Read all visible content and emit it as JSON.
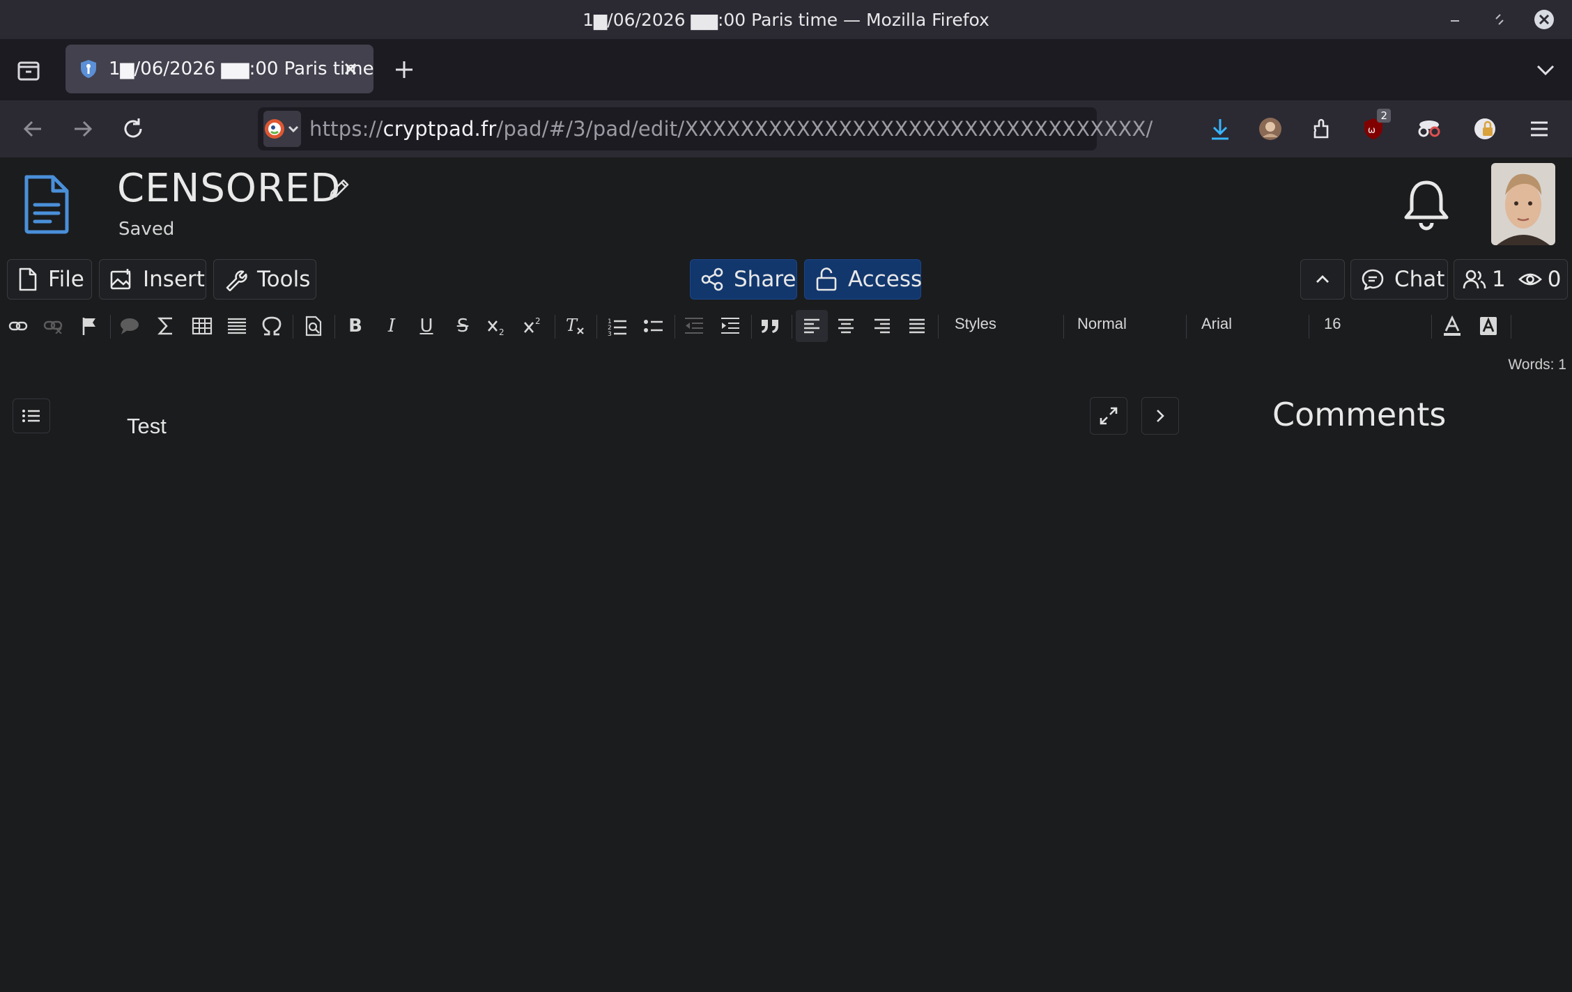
{
  "browser": {
    "window_title": "1▆/06/2026 ▆▆:00 Paris time — Mozilla Firefox",
    "tab_title": "1▆/06/2026 ▆▆:00 Paris time",
    "url": {
      "scheme": "https://",
      "host": "cryptpad.fr",
      "path": "/pad/#/3/pad/edit/XXXXXXXXXXXXXXXXXXXXXXXXXXXXXXXXX/"
    },
    "extension_badge": "2",
    "icons": [
      "back-icon",
      "forward-icon",
      "reload-icon",
      "download-icon",
      "profile-icon",
      "extensions-icon",
      "ublock-icon",
      "privacy-icon",
      "lock-extension-icon",
      "menu-icon"
    ]
  },
  "app": {
    "doc_title": "CENSORED",
    "save_status": "Saved",
    "menu": {
      "file": "File",
      "insert": "Insert",
      "tools": "Tools",
      "share": "Share",
      "access": "Access",
      "chat": "Chat",
      "users_count": "1",
      "viewers_count": "0"
    },
    "toolbar": {
      "styles": "Styles",
      "format": "Normal",
      "font": "Arial",
      "size": "16"
    },
    "word_count": "Words: 1",
    "document_text": "Test",
    "comments_title": "Comments"
  },
  "colors": {
    "accent_button": "#12376d",
    "background": "#1b1c1e",
    "app_icon": "#4a90d9"
  }
}
